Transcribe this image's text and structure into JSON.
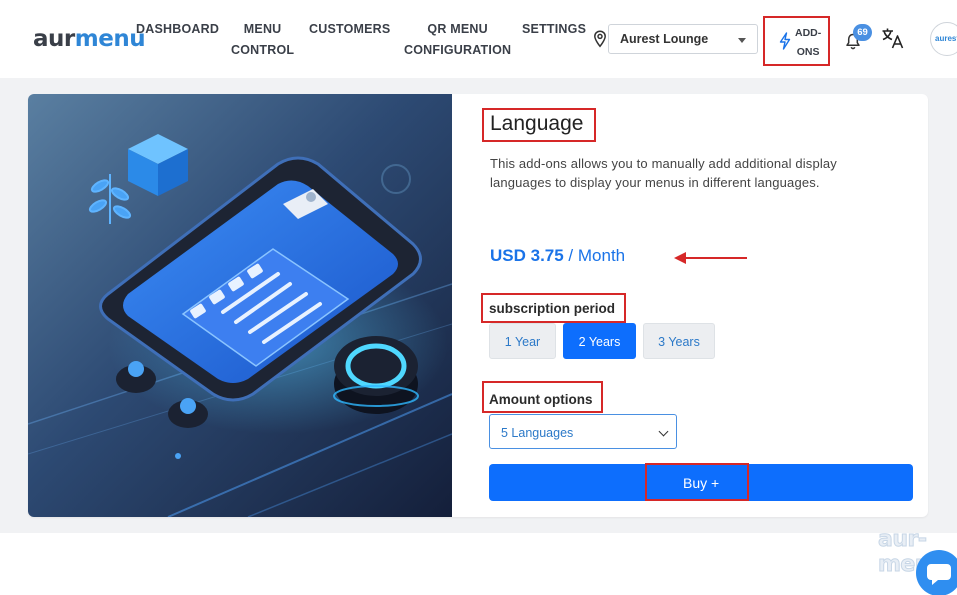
{
  "brand": {
    "logo_part1": "aur",
    "logo_part2": "menu"
  },
  "nav": {
    "dashboard": "DASHBOARD",
    "menu_control": "MENU\nCONTROL",
    "customers": "CUSTOMERS",
    "qr_menu": "QR MENU\nCONFIGURATION",
    "settings": "SETTINGS"
  },
  "venue": {
    "selected": "Aurest Lounge"
  },
  "addons": {
    "label": "ADD-\nONS"
  },
  "notifications": {
    "count": "69"
  },
  "avatar": {
    "text": "aurest"
  },
  "product": {
    "title": "Language",
    "description": "This add-ons allows you to manually add additional display languages to display your menus in different languages.",
    "price_amount": "USD 3.75",
    "price_period": " / Month"
  },
  "subscription": {
    "label": "subscription period",
    "options": [
      "1 Year",
      "2 Years",
      "3 Years"
    ],
    "selected": "2 Years"
  },
  "amount": {
    "label": "Amount options",
    "selected": "5 Languages"
  },
  "buy": {
    "label": "Buy +"
  },
  "watermark": "aur-menu",
  "colors": {
    "primary": "#0d6efd",
    "highlight": "#d62828",
    "brand_blue": "#2f86d6"
  }
}
